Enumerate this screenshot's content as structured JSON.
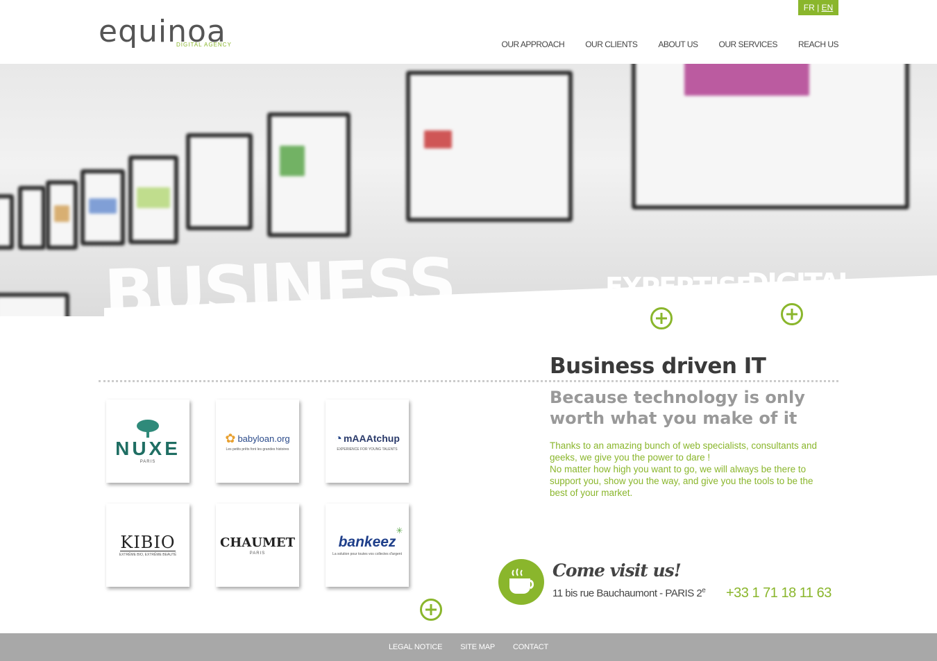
{
  "lang": {
    "fr": "FR",
    "sep": "|",
    "en": "EN"
  },
  "logo": {
    "word": "equinoa",
    "tagline": "DIGITAL AGENCY"
  },
  "nav": [
    {
      "label": "OUR APPROACH"
    },
    {
      "label": "OUR CLIENTS"
    },
    {
      "label": "ABOUT US"
    },
    {
      "label": "OUR SERVICES"
    },
    {
      "label": "REACH US"
    }
  ],
  "hero": {
    "word1": "BUSINESS",
    "word2": "EXPERTISE",
    "word3": "DIGITAL"
  },
  "main": {
    "title": "Business driven IT",
    "subtitle": "Because technology is only worth what you make of it",
    "para1": "Thanks to an amazing bunch of web specialists, consultants and geeks, we give you the power to dare !",
    "para2": "No matter how high you want to go, we will always be there to support you, show you the way, and give you the tools to be the best of your market."
  },
  "clients": [
    {
      "name": "NUXE",
      "sub": "PARIS"
    },
    {
      "name": "babyloan.org",
      "sub": "Les petits prêts font les grandes histoires"
    },
    {
      "name": "mAAAtchup",
      "sub": "EXPERIENCE FOR YOUNG TALENTS"
    },
    {
      "name": "KIBIO",
      "sub": "EXTRÊME BIO, EXTRÊME BEAUTÉ"
    },
    {
      "name": "CHAUMET",
      "sub": "PARIS"
    },
    {
      "name": "bankeez",
      "sub": "La solution pour toutes vos collectes d'argent"
    }
  ],
  "visit": {
    "title": "Come visit us!",
    "address": "11 bis rue Bauchaumont - PARIS 2",
    "address_sup": "e",
    "phone": "+33 1 71 18 11 63"
  },
  "footer": [
    {
      "label": "LEGAL NOTICE"
    },
    {
      "label": "SITE MAP"
    },
    {
      "label": "CONTACT"
    }
  ],
  "colors": {
    "accent": "#8ab62c",
    "footer": "#a8a8a8",
    "text": "#444444"
  }
}
